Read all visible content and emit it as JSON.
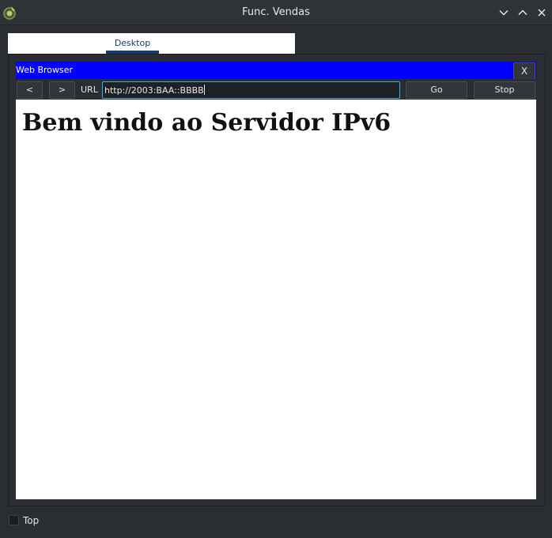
{
  "window": {
    "title": "Func. Vendas"
  },
  "tabs": [
    {
      "label": "Desktop",
      "active": true
    }
  ],
  "browser": {
    "title": "Web Browser",
    "close_label": "X",
    "back_label": "<",
    "forward_label": ">",
    "url_label": "URL",
    "url_value": "http://2003:BAA::BBBB",
    "go_label": "Go",
    "stop_label": "Stop",
    "title_bar_color": "#0000ff"
  },
  "page": {
    "heading": "Bem vindo ao Servidor IPv6"
  },
  "footer": {
    "top_label": "Top",
    "top_checked": false
  },
  "icons": {
    "app": "app-icon",
    "minimize": "chevron-down-icon",
    "maximize": "chevron-up-icon",
    "close": "close-icon"
  }
}
